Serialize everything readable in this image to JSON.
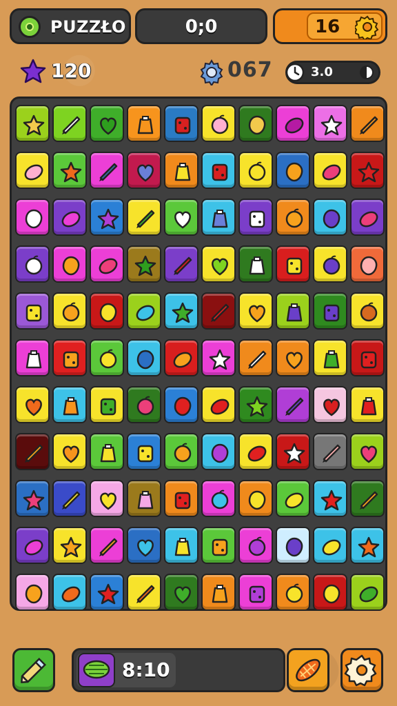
{
  "header": {
    "logo_text": "PUZZŁO",
    "score_text": "0;0",
    "level_text": "16",
    "gear_icon": "gear-icon"
  },
  "stats": {
    "stars": "120",
    "moves": "067",
    "timer": "3.0"
  },
  "bottom": {
    "time": "8:10"
  },
  "board": {
    "rows": 11,
    "cols": 10,
    "tiles": [
      [
        "#9bd11c",
        "#7ed321",
        "#3fae2a",
        "#f7941d",
        "#2a7bc4",
        "#f7e32b",
        "#2f7a1f",
        "#ec3fd6",
        "#ec6fe6",
        "#f08a1c"
      ],
      [
        "#f7e32b",
        "#5bc83a",
        "#ec3fd6",
        "#c21a4e",
        "#f08a1c",
        "#3dc2e8",
        "#f7e32b",
        "#2b6fc4",
        "#f7e32b",
        "#c81818"
      ],
      [
        "#ec3fd6",
        "#7b3ec9",
        "#2b80d6",
        "#f7e32b",
        "#5bc83a",
        "#3dc2e8",
        "#7b3ec9",
        "#f08a1c",
        "#3dc2e8",
        "#7b3ec9"
      ],
      [
        "#7b3ec9",
        "#ec3fd6",
        "#ec3fd6",
        "#9b7a1c",
        "#7b3ec9",
        "#f7e32b",
        "#2f7a1f",
        "#d81e1e",
        "#f7e32b",
        "#f06a3a"
      ],
      [
        "#9b58d6",
        "#f7e32b",
        "#c81818",
        "#9bd11c",
        "#3dc2e8",
        "#8a1010",
        "#f7e32b",
        "#9bd11c",
        "#2f8a1f",
        "#f7e32b"
      ],
      [
        "#ec3fd6",
        "#e02020",
        "#5bc83a",
        "#3dc2e8",
        "#d81e1e",
        "#ec3fd6",
        "#f08a1c",
        "#f08a1c",
        "#f7e32b",
        "#c81818"
      ],
      [
        "#f7e32b",
        "#3dc2e8",
        "#f7e32b",
        "#2f7a1f",
        "#2b80d6",
        "#f7e32b",
        "#2f8a1f",
        "#b03ed6",
        "#f5c6e0",
        "#f7e32b"
      ],
      [
        "#5a0c0c",
        "#f7e32b",
        "#5bc83a",
        "#2b80d6",
        "#5bc83a",
        "#3dc2e8",
        "#f7e32b",
        "#c81818",
        "#777777",
        "#9bd11c"
      ],
      [
        "#2b6fc4",
        "#3a4bc9",
        "#f5a8e6",
        "#9b7a1c",
        "#f08a1c",
        "#ec3fd6",
        "#f08a1c",
        "#5bc83a",
        "#3dc2e8",
        "#2f7a1f"
      ],
      [
        "#7b3ec9",
        "#f7e32b",
        "#ec3fd6",
        "#2b6fc4",
        "#3dc2e8",
        "#5bc83a",
        "#ec3fd6",
        "#cfeeff",
        "#3dc2e8",
        "#3dc2e8"
      ],
      [
        "#f5a8e6",
        "#3dc2e8",
        "#2b80d6",
        "#f7e32b",
        "#2f7a1f",
        "#f08a1c",
        "#ec3fd6",
        "#f08a1c",
        "#c81818",
        "#9bd11c"
      ]
    ],
    "glyphs": [
      [
        "#f2c94c",
        "#ffffff",
        "#2e9e1e",
        "#f7941d",
        "#d82020",
        "#ffb0d0",
        "#f2c94c",
        "#b51aa3",
        "#ffffff",
        "#f7941d"
      ],
      [
        "#ffb0d0",
        "#f06a1c",
        "#3a6fa8",
        "#6a7fd8",
        "#f7e32b",
        "#d82020",
        "#f7e32b",
        "#f7a21d",
        "#ec3f7a",
        "#d82020"
      ],
      [
        "#ffffff",
        "#ec3fd6",
        "#b03ed6",
        "#3fae2a",
        "#ffffff",
        "#6a7fd8",
        "#ffffff",
        "#f7a21d",
        "#6a3fc9",
        "#ec3f7a"
      ],
      [
        "#ffffff",
        "#f7a21d",
        "#ec3f7a",
        "#2e9e1e",
        "#d82020",
        "#7ed321",
        "#ffffff",
        "#f7e32b",
        "#6a3fc9",
        "#ffb0b0"
      ],
      [
        "#f7e32b",
        "#f7a21d",
        "#f7e32b",
        "#3dc2e8",
        "#3fae2a",
        "#d82020",
        "#f7a21d",
        "#6a3fc9",
        "#6a3fc9",
        "#d86a20"
      ],
      [
        "#ffffff",
        "#f7a21d",
        "#f7e32b",
        "#2b6fc4",
        "#f7a21d",
        "#ffffff",
        "#ffffff",
        "#f7a21d",
        "#3fae2a",
        "#e02020"
      ],
      [
        "#f06a1c",
        "#f7941d",
        "#3fae2a",
        "#ec3f7a",
        "#e02020",
        "#e02020",
        "#7ed321",
        "#6a3fc9",
        "#d82020",
        "#e02020"
      ],
      [
        "#f7a21d",
        "#f7941d",
        "#f7e32b",
        "#f7e32b",
        "#f7a21d",
        "#b03ed6",
        "#e02020",
        "#ffffff",
        "#ffb0b0",
        "#ec3f7a"
      ],
      [
        "#ec3f7a",
        "#f7e32b",
        "#f7e32b",
        "#f5a8e6",
        "#e02020",
        "#3dc2e8",
        "#f7e32b",
        "#f7e32b",
        "#e02020",
        "#f7a21d"
      ],
      [
        "#ec3fd6",
        "#f7a21d",
        "#f7a21d",
        "#3dc2e8",
        "#f7e32b",
        "#f7a21d",
        "#b03ed6",
        "#6a3fc9",
        "#f7e32b",
        "#f06a1c"
      ],
      [
        "#f7a21d",
        "#f06a1c",
        "#e02020",
        "#f06a1c",
        "#3fae2a",
        "#f7a21d",
        "#b03ed6",
        "#f7e32b",
        "#f7e32b",
        "#3fae2a"
      ]
    ]
  }
}
